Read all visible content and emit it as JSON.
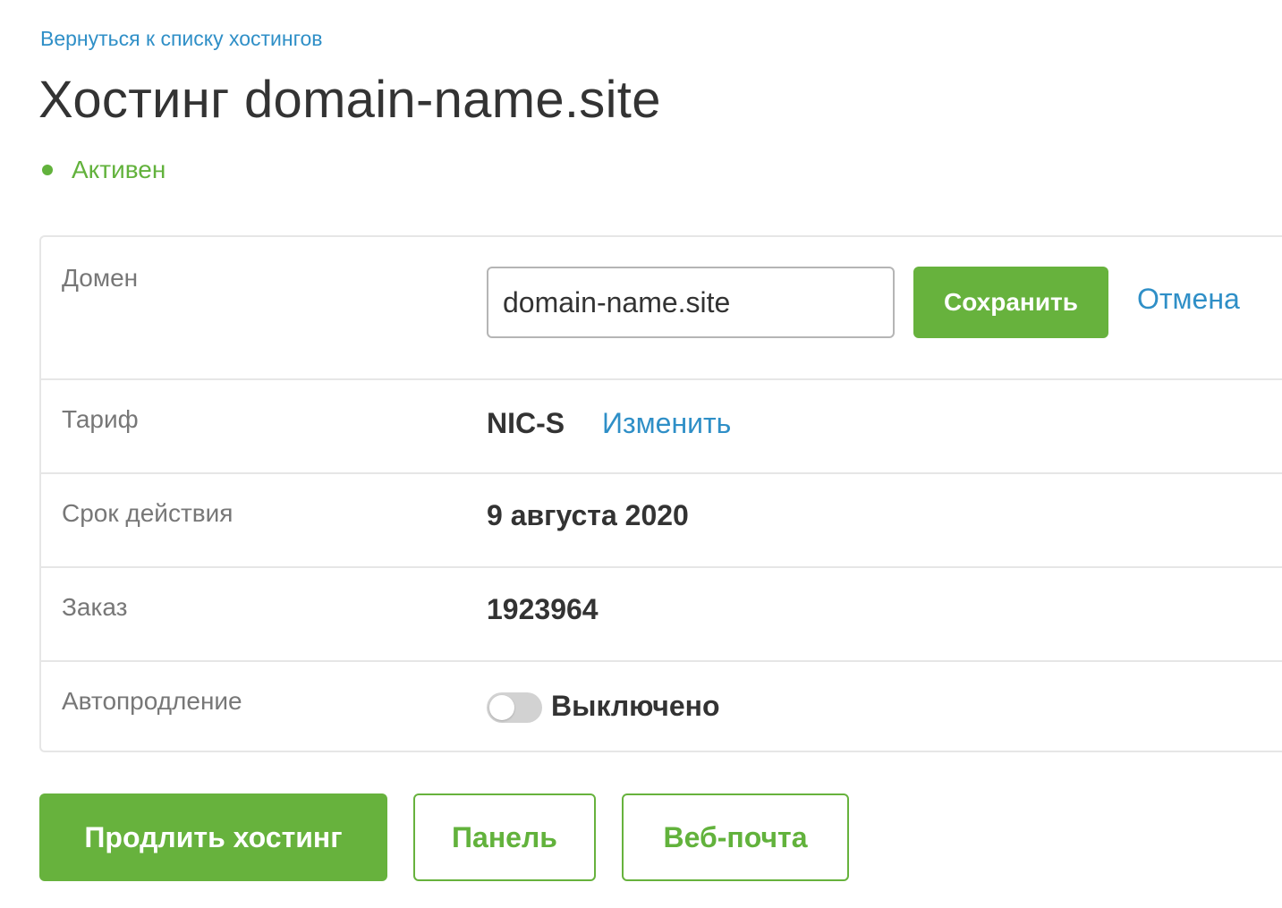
{
  "header": {
    "back_link": "Вернуться к списку хостингов",
    "title": "Хостинг domain-name.site",
    "status": "Активен"
  },
  "details": {
    "domain": {
      "label": "Домен",
      "value": "domain-name.site",
      "save_label": "Сохранить",
      "cancel_label": "Отмена"
    },
    "tariff": {
      "label": "Тариф",
      "value": "NIC-S",
      "change_label": "Изменить"
    },
    "expiry": {
      "label": "Срок действия",
      "value": "9 августа 2020"
    },
    "order": {
      "label": "Заказ",
      "value": "1923964"
    },
    "autorenew": {
      "label": "Автопродление",
      "enabled": false,
      "state_label": "Выключено"
    }
  },
  "actions": {
    "renew_label": "Продлить хостинг",
    "panel_label": "Панель",
    "webmail_label": "Веб-почта"
  },
  "colors": {
    "accent_green": "#67b23d",
    "link_blue": "#2f8fc7",
    "status_green": "#62b23c"
  }
}
